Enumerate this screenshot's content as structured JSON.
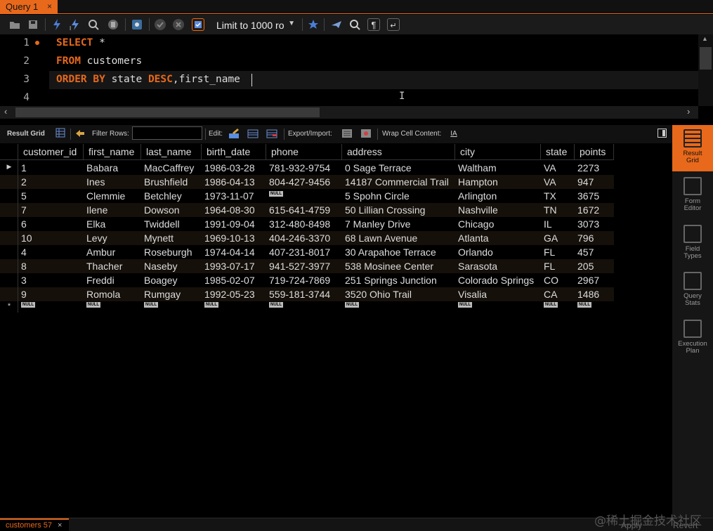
{
  "tabs": {
    "query_tab": "Query 1",
    "close": "×"
  },
  "toolbar": {
    "limit_label": "Limit to 1000 ro",
    "icons": [
      "open-folder-icon",
      "save-icon",
      "execute-icon",
      "execute-current-icon",
      "explain-icon",
      "stop-icon",
      "toggle-output-icon",
      "commit-icon",
      "rollback-icon",
      "autocommit-icon",
      "limit-dropdown",
      "add-snippet-icon",
      "beautify-icon",
      "find-icon",
      "invisible-chars-icon",
      "wrap-icon"
    ]
  },
  "editor": {
    "line_numbers": [
      "1",
      "2",
      "3",
      "4"
    ],
    "lines": [
      {
        "kw1": "SELECT",
        "rest": " *"
      },
      {
        "kw1": "FROM",
        "rest": " customers"
      },
      {
        "kw1": "ORDER BY",
        "mid": " state ",
        "kw2": "DESC",
        "rest": ",first_name "
      }
    ]
  },
  "result_toolbar": {
    "result_grid": "Result Grid",
    "filter_rows": "Filter Rows:",
    "edit": "Edit:",
    "export_import": "Export/Import:",
    "wrap_cell": "Wrap Cell Content:"
  },
  "grid": {
    "columns": [
      "customer_id",
      "first_name",
      "last_name",
      "birth_date",
      "phone",
      "address",
      "city",
      "state",
      "points"
    ],
    "rows": [
      [
        "1",
        "Babara",
        "MacCaffrey",
        "1986-03-28",
        "781-932-9754",
        "0 Sage Terrace",
        "Waltham",
        "VA",
        "2273"
      ],
      [
        "2",
        "Ines",
        "Brushfield",
        "1986-04-13",
        "804-427-9456",
        "14187 Commercial Trail",
        "Hampton",
        "VA",
        "947"
      ],
      [
        "5",
        "Clemmie",
        "Betchley",
        "1973-11-07",
        "NULL",
        "5 Spohn Circle",
        "Arlington",
        "TX",
        "3675"
      ],
      [
        "7",
        "Ilene",
        "Dowson",
        "1964-08-30",
        "615-641-4759",
        "50 Lillian Crossing",
        "Nashville",
        "TN",
        "1672"
      ],
      [
        "6",
        "Elka",
        "Twiddell",
        "1991-09-04",
        "312-480-8498",
        "7 Manley Drive",
        "Chicago",
        "IL",
        "3073"
      ],
      [
        "10",
        "Levy",
        "Mynett",
        "1969-10-13",
        "404-246-3370",
        "68 Lawn Avenue",
        "Atlanta",
        "GA",
        "796"
      ],
      [
        "4",
        "Ambur",
        "Roseburgh",
        "1974-04-14",
        "407-231-8017",
        "30 Arapahoe Terrace",
        "Orlando",
        "FL",
        "457"
      ],
      [
        "8",
        "Thacher",
        "Naseby",
        "1993-07-17",
        "941-527-3977",
        "538 Mosinee Center",
        "Sarasota",
        "FL",
        "205"
      ],
      [
        "3",
        "Freddi",
        "Boagey",
        "1985-02-07",
        "719-724-7869",
        "251 Springs Junction",
        "Colorado Springs",
        "CO",
        "2967"
      ],
      [
        "9",
        "Romola",
        "Rumgay",
        "1992-05-23",
        "559-181-3744",
        "3520 Ohio Trail",
        "Visalia",
        "CA",
        "1486"
      ]
    ],
    "null_label": "NULL",
    "new_row_marker": "*",
    "current_row_marker": "▶"
  },
  "side_panel": {
    "result_grid": [
      "Result",
      "Grid"
    ],
    "form_editor": [
      "Form",
      "Editor"
    ],
    "field_types": [
      "Field",
      "Types"
    ],
    "query_stats": [
      "Query",
      "Stats"
    ],
    "execution_plan": [
      "Execution",
      "Plan"
    ]
  },
  "bottom": {
    "tab_label": "customers 57",
    "close": "×",
    "apply": "Apply",
    "revert": "Revert"
  },
  "watermark": "@稀土掘金技术社区",
  "colors": {
    "accent": "#e8691b",
    "background": "#000000"
  }
}
